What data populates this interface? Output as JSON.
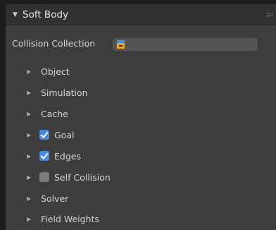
{
  "panel": {
    "title": "Soft Body",
    "collision_collection": {
      "label": "Collision Collection",
      "value": "",
      "icon": "collection-icon"
    },
    "subpanels": [
      {
        "label": "Object",
        "checkbox": null
      },
      {
        "label": "Simulation",
        "checkbox": null
      },
      {
        "label": "Cache",
        "checkbox": null
      },
      {
        "label": "Goal",
        "checkbox": true
      },
      {
        "label": "Edges",
        "checkbox": true
      },
      {
        "label": "Self Collision",
        "checkbox": false
      },
      {
        "label": "Solver",
        "checkbox": null
      },
      {
        "label": "Field Weights",
        "checkbox": null
      }
    ]
  },
  "colors": {
    "checkbox_on": "#4a8ad8",
    "checkbox_off": "#7a7a7a",
    "panel_bg": "#3d3d3d",
    "header_bg": "#313131"
  }
}
